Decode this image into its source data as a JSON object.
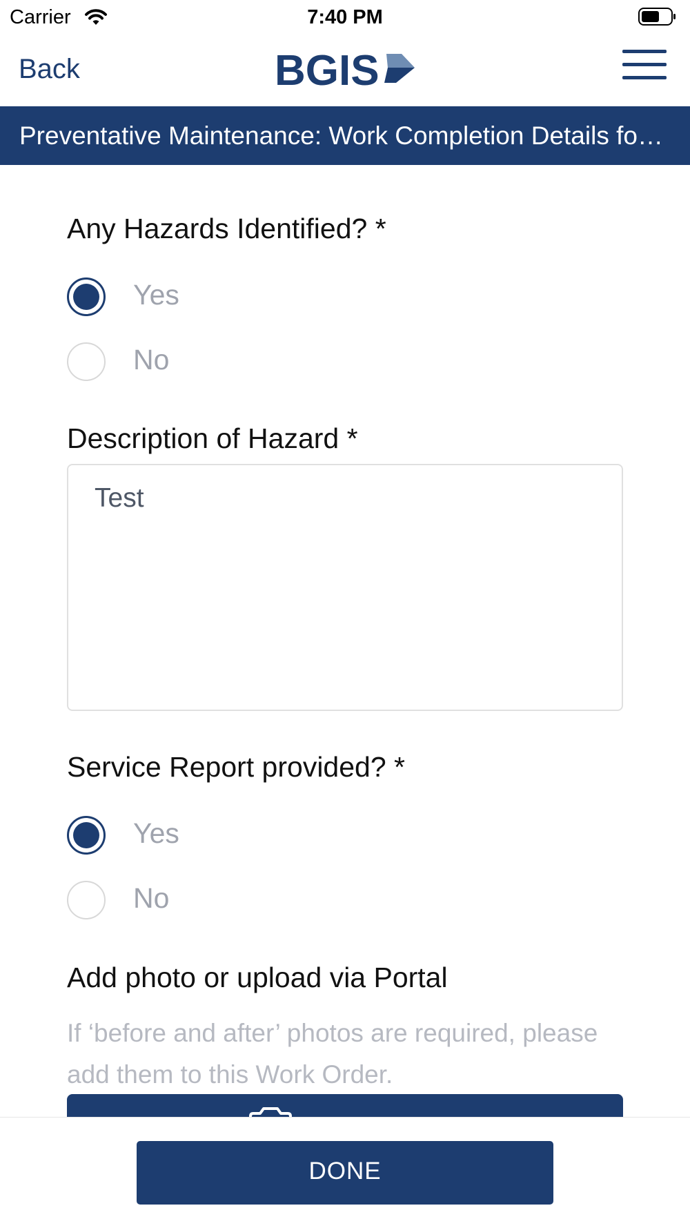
{
  "status_bar": {
    "carrier": "Carrier",
    "time": "7:40 PM"
  },
  "nav": {
    "back_label": "Back",
    "logo_text": "BGIS",
    "brand_color": "#1d3d70"
  },
  "title": "Preventative Maintenance: Work Completion Details for Test",
  "hazards": {
    "label": "Any Hazards Identified? *",
    "options": [
      {
        "label": "Yes",
        "selected": true
      },
      {
        "label": "No",
        "selected": false
      }
    ]
  },
  "description": {
    "label": "Description of Hazard *",
    "value": "Test"
  },
  "service_report": {
    "label": "Service Report provided? *",
    "options": [
      {
        "label": "Yes",
        "selected": true
      },
      {
        "label": "No",
        "selected": false
      }
    ]
  },
  "photo": {
    "label": "Add photo or upload via Portal",
    "helper": "If ‘before and after’ photos are required, please add them to this Work Order.",
    "icon": "camera-icon"
  },
  "footer": {
    "done_label": "DONE"
  }
}
